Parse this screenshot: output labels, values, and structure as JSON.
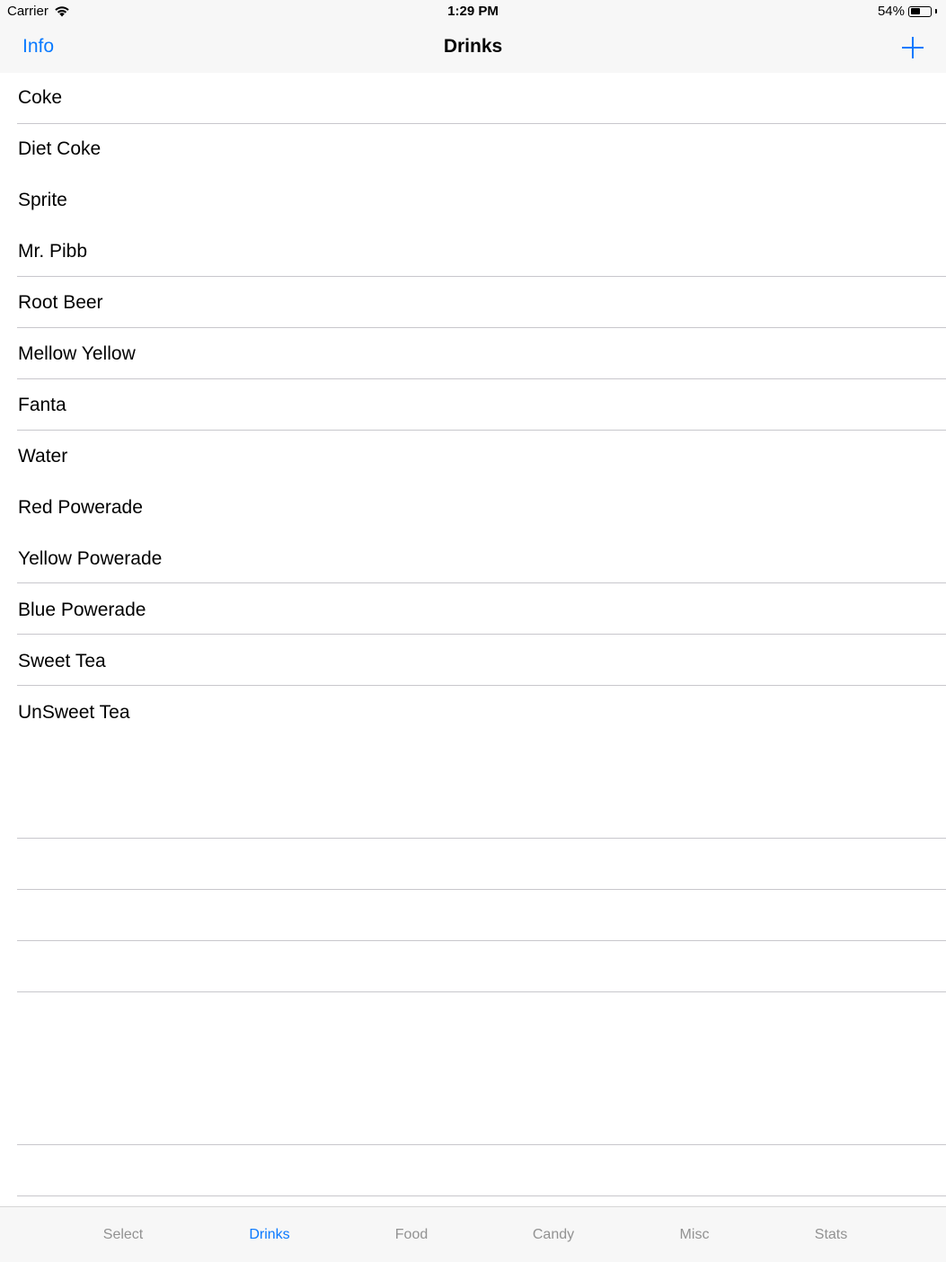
{
  "status_bar": {
    "carrier": "Carrier",
    "time": "1:29 PM",
    "battery": "54%",
    "battery_level": 0.54,
    "icons": [
      "wifi-icon",
      "battery-icon"
    ]
  },
  "nav_bar": {
    "left_button": "Info",
    "title": "Drinks",
    "right_icon": "plus-icon"
  },
  "drinks": [
    "Coke",
    "Diet Coke",
    "Sprite",
    "Mr. Pibb",
    "Root Beer",
    "Mellow Yellow",
    "Fanta",
    "Water",
    "Red Powerade",
    "Yellow Powerade",
    "Blue Powerade",
    "Sweet Tea",
    "UnSweet Tea"
  ],
  "tab_bar": {
    "tabs": [
      "Select",
      "Drinks",
      "Food",
      "Candy",
      "Misc",
      "Stats"
    ],
    "active": "Drinks"
  },
  "colors": {
    "accent": "#0a7aff",
    "inactive_tab": "#929292",
    "separator": "#c8c7cc",
    "bar_background": "#f7f7f7"
  }
}
